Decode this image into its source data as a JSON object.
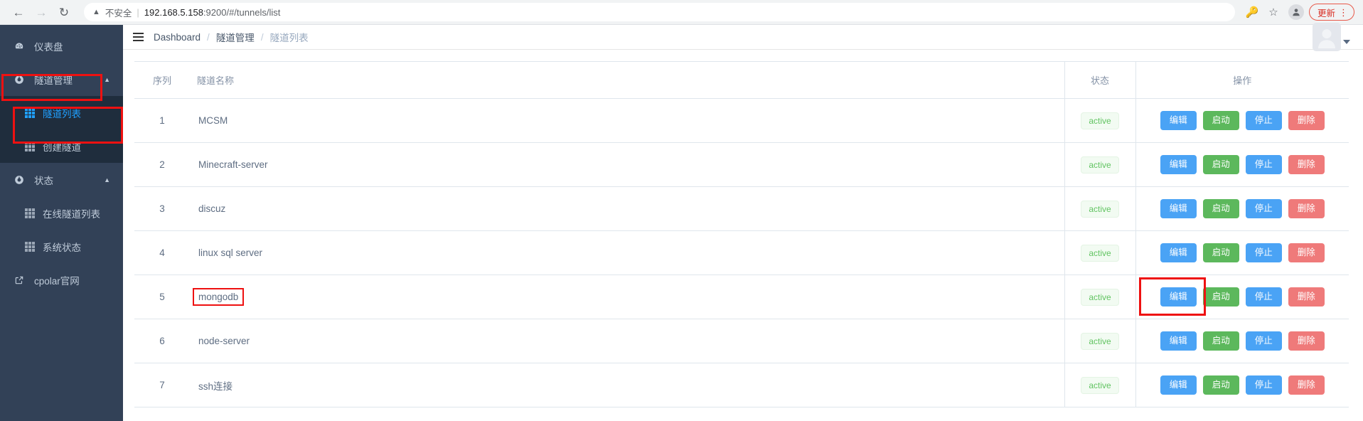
{
  "browser": {
    "back_icon": "arrow-left-icon",
    "forward_icon": "arrow-right-icon",
    "reload_icon": "reload-icon",
    "warning_icon": "warning-triangle-icon",
    "security_label": "不安全",
    "separator": "|",
    "url_host": "192.168.5.158",
    "url_rest": ":9200/#/tunnels/list",
    "key_icon": "key-icon",
    "bookmark_icon": "star-icon",
    "profile_icon": "profile-avatar-icon",
    "update_label": "更新",
    "menu_icon": "kebab-menu-icon"
  },
  "sidebar": {
    "bg_color": "#324157",
    "submenu_bg_color": "#1f2d3d",
    "active_color": "#20a0ff",
    "items": [
      {
        "label": "仪表盘",
        "icon": "dashboard-icon",
        "type": "item"
      },
      {
        "label": "隧道管理",
        "icon": "compass-icon",
        "type": "group",
        "chevron": "chevron-up-icon",
        "highlighted": true
      },
      {
        "label": "隧道列表",
        "icon": "grid-icon",
        "type": "sub",
        "active": true,
        "highlighted": true
      },
      {
        "label": "创建隧道",
        "icon": "grid-icon",
        "type": "sub",
        "active": false
      },
      {
        "label": "状态",
        "icon": "compass-icon",
        "type": "group",
        "chevron": "chevron-up-icon"
      },
      {
        "label": "在线隧道列表",
        "icon": "grid-icon",
        "type": "sub",
        "active": false
      },
      {
        "label": "系统状态",
        "icon": "grid-icon",
        "type": "sub",
        "active": false
      },
      {
        "label": "cpolar官网",
        "icon": "external-link-icon",
        "type": "link"
      }
    ]
  },
  "topbar": {
    "menu_toggle_icon": "hamburger-collapse-icon",
    "breadcrumb": [
      {
        "label": "Dashboard",
        "last": false
      },
      {
        "label": "隧道管理",
        "last": false
      },
      {
        "label": "隧道列表",
        "last": true
      }
    ],
    "separator": "/",
    "avatar_icon": "user-avatar-icon",
    "caret_icon": "caret-down-icon"
  },
  "table": {
    "headers": {
      "seq": "序列",
      "name": "隧道名称",
      "state": "状态",
      "ops": "操作"
    },
    "buttons": {
      "edit": "编辑",
      "start": "启动",
      "stop": "停止",
      "delete": "删除"
    },
    "colors": {
      "edit": "#4aa3f5",
      "start": "#5cb85c",
      "stop": "#4aa3f5",
      "delete": "#ef7a7a",
      "tag_text": "#62c462",
      "tag_bg": "#f2fbf2",
      "annotation": "#ee1111"
    },
    "rows": [
      {
        "seq": "1",
        "name": "MCSM",
        "state": "active",
        "name_highlighted": false,
        "edit_highlighted": false
      },
      {
        "seq": "2",
        "name": "Minecraft-server",
        "state": "active",
        "name_highlighted": false,
        "edit_highlighted": false
      },
      {
        "seq": "3",
        "name": "discuz",
        "state": "active",
        "name_highlighted": false,
        "edit_highlighted": false
      },
      {
        "seq": "4",
        "name": "linux sql server",
        "state": "active",
        "name_highlighted": false,
        "edit_highlighted": false
      },
      {
        "seq": "5",
        "name": "mongodb",
        "state": "active",
        "name_highlighted": true,
        "edit_highlighted": true
      },
      {
        "seq": "6",
        "name": "node-server",
        "state": "active",
        "name_highlighted": false,
        "edit_highlighted": false
      },
      {
        "seq": "7",
        "name": "ssh连接",
        "state": "active",
        "name_highlighted": false,
        "edit_highlighted": false
      }
    ]
  }
}
